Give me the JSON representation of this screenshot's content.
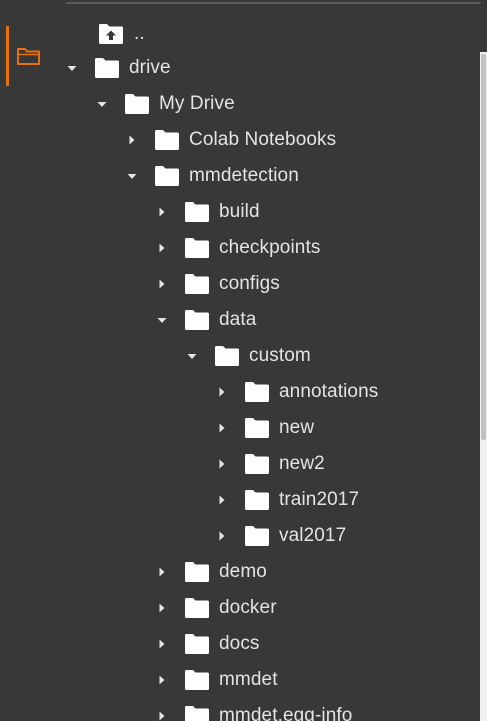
{
  "sidebar": {
    "active_tool_icon": "folder-icon",
    "accent_color": "#e8710a"
  },
  "tree": {
    "parent_link": "..",
    "rows": [
      {
        "label": "drive",
        "depth": 0,
        "state": "expanded"
      },
      {
        "label": "My Drive",
        "depth": 1,
        "state": "expanded"
      },
      {
        "label": "Colab Notebooks",
        "depth": 2,
        "state": "collapsed"
      },
      {
        "label": "mmdetection",
        "depth": 2,
        "state": "expanded"
      },
      {
        "label": "build",
        "depth": 3,
        "state": "collapsed"
      },
      {
        "label": "checkpoints",
        "depth": 3,
        "state": "collapsed"
      },
      {
        "label": "configs",
        "depth": 3,
        "state": "collapsed"
      },
      {
        "label": "data",
        "depth": 3,
        "state": "expanded"
      },
      {
        "label": "custom",
        "depth": 4,
        "state": "expanded"
      },
      {
        "label": "annotations",
        "depth": 5,
        "state": "collapsed"
      },
      {
        "label": "new",
        "depth": 5,
        "state": "collapsed"
      },
      {
        "label": "new2",
        "depth": 5,
        "state": "collapsed"
      },
      {
        "label": "train2017",
        "depth": 5,
        "state": "collapsed"
      },
      {
        "label": "val2017",
        "depth": 5,
        "state": "collapsed"
      },
      {
        "label": "demo",
        "depth": 3,
        "state": "collapsed"
      },
      {
        "label": "docker",
        "depth": 3,
        "state": "collapsed"
      },
      {
        "label": "docs",
        "depth": 3,
        "state": "collapsed"
      },
      {
        "label": "mmdet",
        "depth": 3,
        "state": "collapsed"
      },
      {
        "label": "mmdet.egg-info",
        "depth": 3,
        "state": "collapsed"
      }
    ]
  }
}
